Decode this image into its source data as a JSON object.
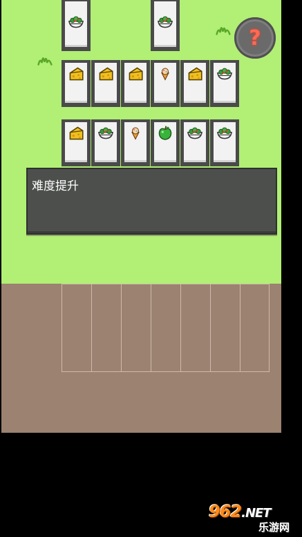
{
  "message": {
    "text": "难度提升"
  },
  "help_button": {
    "label": "?"
  },
  "watermark": {
    "number": "962",
    "suffix": ".NET",
    "sub": "乐游网"
  },
  "top_row": [
    "salad-bowl-icon",
    "salad-bowl-icon"
  ],
  "row_1": [
    "cheese-icon",
    "cheese-icon",
    "cheese-icon",
    "ice-cream-icon",
    "cheese-icon",
    "salad-bowl-icon"
  ],
  "row_2": [
    "cheese-icon",
    "salad-bowl-icon",
    "ice-cream-icon",
    "apple-icon",
    "salad-bowl-icon",
    "salad-bowl-icon"
  ],
  "tray_slots": 7
}
